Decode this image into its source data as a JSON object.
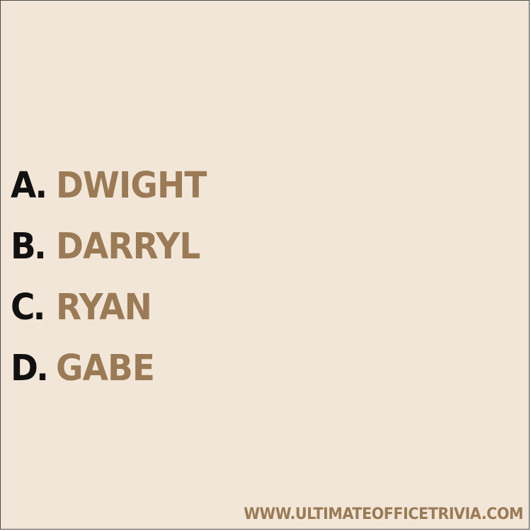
{
  "options": [
    {
      "letter": "A.",
      "answer": "DWIGHT"
    },
    {
      "letter": "B.",
      "answer": "DARRYL"
    },
    {
      "letter": "C.",
      "answer": "RYAN"
    },
    {
      "letter": "D.",
      "answer": "GABE"
    }
  ],
  "footer": {
    "website": "WWW.ULTIMATEOFFICETRIVIA.COM"
  },
  "colors": {
    "background": "#f2e6d8",
    "letter": "#111111",
    "accent": "#9a7b55"
  }
}
